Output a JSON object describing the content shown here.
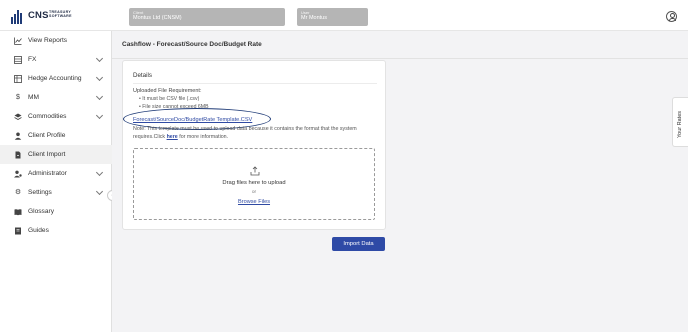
{
  "header": {
    "brand": "CNS",
    "brand_sub_line1": "TREASURY",
    "brand_sub_line2": "SOFTWARE",
    "client_label": "Client",
    "client_value": "Montus Ltd (CNSM)",
    "user_label": "User",
    "user_value": "Mr Montus"
  },
  "sidebar": {
    "items": [
      {
        "label": "View Reports",
        "icon": "chart-icon",
        "has_chevron": false
      },
      {
        "label": "FX",
        "icon": "table-icon",
        "has_chevron": true
      },
      {
        "label": "Hedge Accounting",
        "icon": "table-icon",
        "has_chevron": true
      },
      {
        "label": "MM",
        "icon": "dollar-icon",
        "has_chevron": true
      },
      {
        "label": "Commodities",
        "icon": "layers-icon",
        "has_chevron": true
      },
      {
        "label": "Client Profile",
        "icon": "person-icon",
        "has_chevron": false
      },
      {
        "label": "Client Import",
        "icon": "file-import-icon",
        "has_chevron": false,
        "active": true
      },
      {
        "label": "Administrator",
        "icon": "admin-icon",
        "has_chevron": true
      },
      {
        "label": "Settings",
        "icon": "gear-icon",
        "has_chevron": true
      },
      {
        "label": "Glossary",
        "icon": "book-icon",
        "has_chevron": false
      },
      {
        "label": "Guides",
        "icon": "guide-icon",
        "has_chevron": false
      }
    ]
  },
  "main": {
    "page_title": "Cashflow - Forecast/Source Doc/Budget Rate",
    "card": {
      "title": "Details",
      "requirements_title": "Uploaded File Requirement:",
      "requirements": [
        "• It must be CSV file (.csv)",
        "• File size cannot exceed 6MB"
      ],
      "template_link": "Forecast/SourceDoc/BudgetRate Template.CSV",
      "note_prefix": "Note: This template must be used to upload data because it contains the format that the system requires.Click ",
      "note_link": "here",
      "note_suffix": " for more information.",
      "dropzone_text": "Drag files here to upload",
      "dropzone_or": "or",
      "dropzone_browse": "Browse Files"
    },
    "import_button": "Import Data"
  },
  "side_tab": "Your Rates",
  "colors": {
    "accent": "#2e4aa6",
    "link": "#2f4aa3",
    "highlight_ellipse": "#1f3b77"
  }
}
